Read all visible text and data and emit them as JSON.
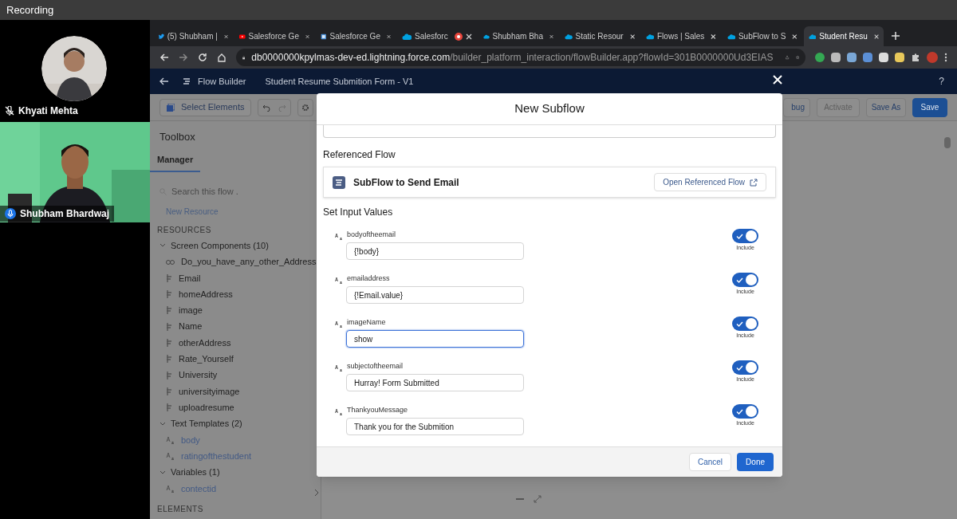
{
  "recorder": {
    "title": "Recording"
  },
  "participants": [
    {
      "name": "Khyati Mehta",
      "muted": true,
      "kind": "avatar"
    },
    {
      "name": "Shubham Bhardwaj",
      "muted": false,
      "kind": "video"
    }
  ],
  "browser": {
    "tabs": [
      {
        "label": "(5) Shubham |",
        "kind": "bird",
        "recording": false,
        "selected": false
      },
      {
        "label": "Salesforce Ge",
        "kind": "play",
        "recording": false,
        "selected": false
      },
      {
        "label": "Salesforce Ge",
        "kind": "doc",
        "recording": false,
        "selected": false
      },
      {
        "label": "Salesforc",
        "kind": "cloud",
        "recording": true,
        "selected": false
      },
      {
        "label": "Shubham Bha",
        "kind": "cloud",
        "recording": false,
        "selected": false
      },
      {
        "label": "Static Resour",
        "kind": "cloud",
        "recording": false,
        "selected": false
      },
      {
        "label": "Flows | Sales",
        "kind": "cloud",
        "recording": false,
        "selected": false
      },
      {
        "label": "SubFlow to S",
        "kind": "cloud",
        "recording": false,
        "selected": false
      },
      {
        "label": "Student Resu",
        "kind": "cloud",
        "recording": false,
        "selected": true
      }
    ],
    "url_host": "db0000000kpylmas-dev-ed.lightning.force.com",
    "url_path": "/builder_platform_interaction/flowBuilder.app?flowId=301B0000000Ud3EIAS"
  },
  "app": {
    "title": "Flow Builder",
    "flow_name": "Student Resume Submition Form - V1",
    "help": "?",
    "select_elements": "Select Elements",
    "actions": [
      {
        "label": "bug",
        "kind": "neutral",
        "disabled": false
      },
      {
        "label": "Activate",
        "kind": "neutral",
        "disabled": true
      },
      {
        "label": "Save As",
        "kind": "neutral",
        "disabled": false
      },
      {
        "label": "Save",
        "kind": "brand",
        "disabled": false
      }
    ]
  },
  "toolbox": {
    "title": "Toolbox",
    "tabs": [
      {
        "label": "Manager",
        "selected": true
      }
    ],
    "search_placeholder": "Search this flow .",
    "new_resource": "New Resource",
    "sections": [
      {
        "heading": "RESOURCES",
        "groups": [
          {
            "label": "Screen Components (10)",
            "expanded": true,
            "children": [
              {
                "label": "Do_you_have_any_other_Address",
                "kind": "choice"
              },
              {
                "label": "Email",
                "kind": "field"
              },
              {
                "label": "homeAddress",
                "kind": "field"
              },
              {
                "label": "image",
                "kind": "field"
              },
              {
                "label": "Name",
                "kind": "field"
              },
              {
                "label": "otherAddress",
                "kind": "field"
              },
              {
                "label": "Rate_Yourself",
                "kind": "field"
              },
              {
                "label": "University",
                "kind": "field"
              },
              {
                "label": "universityimage",
                "kind": "field"
              },
              {
                "label": "uploadresume",
                "kind": "field"
              }
            ]
          },
          {
            "label": "Text Templates (2)",
            "expanded": true,
            "children": [
              {
                "label": "body",
                "kind": "text"
              },
              {
                "label": "ratingofthestudent",
                "kind": "text"
              }
            ]
          },
          {
            "label": "Variables (1)",
            "expanded": true,
            "children": [
              {
                "label": "contectid",
                "kind": "text"
              }
            ]
          }
        ]
      },
      {
        "heading": "ELEMENTS"
      }
    ]
  },
  "modal": {
    "title": "New Subflow",
    "referenced_heading": "Referenced Flow",
    "flow_name": "SubFlow to Send Email",
    "open_button": "Open Referenced Flow",
    "inputs_heading": "Set Input Values",
    "inputs": [
      {
        "label": "bodyoftheemail",
        "value": "{!body}",
        "include": true,
        "include_label": "Include",
        "focused": false
      },
      {
        "label": "emailaddress",
        "value": "{!Email.value}",
        "include": true,
        "include_label": "Include",
        "focused": false
      },
      {
        "label": "imageName",
        "value": "show",
        "include": true,
        "include_label": "Include",
        "focused": true
      },
      {
        "label": "subjectoftheemail",
        "value": "Hurray! Form Submitted",
        "include": true,
        "include_label": "Include",
        "focused": false
      },
      {
        "label": "ThankyouMessage",
        "value": "Thank you for the Submition",
        "include": true,
        "include_label": "Include",
        "focused": false
      }
    ],
    "cancel": "Cancel",
    "done": "Done"
  }
}
